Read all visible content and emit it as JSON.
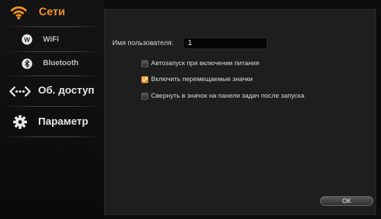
{
  "sidebar": {
    "items": [
      {
        "label": "Сети",
        "icon": "wifi-icon",
        "active": true
      },
      {
        "label": "WiFi",
        "icon": "wifi-badge-icon"
      },
      {
        "label": "Bluetooth",
        "icon": "bluetooth-icon"
      },
      {
        "label": "Об. доступ",
        "icon": "share-icon"
      },
      {
        "label": "Параметр",
        "icon": "gear-icon"
      }
    ]
  },
  "settings": {
    "username_label": "Имя пользователя:",
    "username_value": "1",
    "options": [
      {
        "label": "Автозапуск при включении питания",
        "checked": false
      },
      {
        "label": "Включить перемещаемые значки",
        "checked": true
      },
      {
        "label": "Свернуть в значок на панели задач после запуска",
        "checked": false
      }
    ],
    "ok_label": "OK"
  },
  "colors": {
    "accent": "#f7931e",
    "panel": "#1e1e1e",
    "background": "#0c0c0c"
  }
}
